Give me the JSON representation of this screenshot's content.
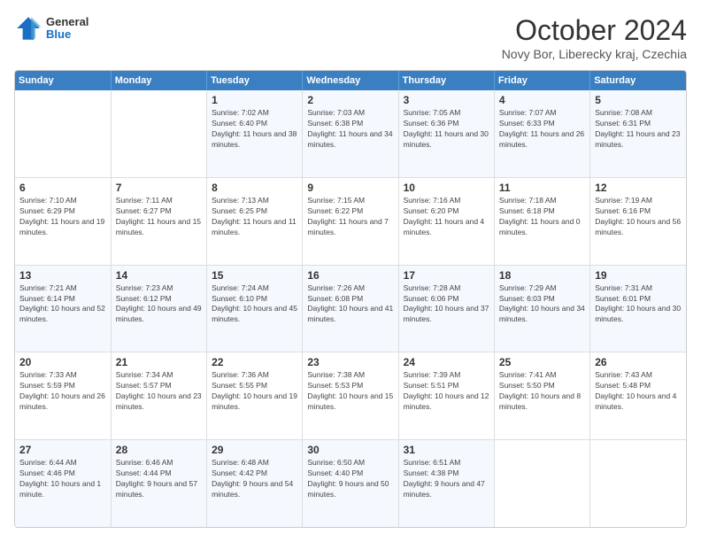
{
  "logo": {
    "general": "General",
    "blue": "Blue"
  },
  "header": {
    "month": "October 2024",
    "location": "Novy Bor, Liberecky kraj, Czechia"
  },
  "days_of_week": [
    "Sunday",
    "Monday",
    "Tuesday",
    "Wednesday",
    "Thursday",
    "Friday",
    "Saturday"
  ],
  "weeks": [
    [
      {
        "day": "",
        "info": ""
      },
      {
        "day": "",
        "info": ""
      },
      {
        "day": "1",
        "info": "Sunrise: 7:02 AM\nSunset: 6:40 PM\nDaylight: 11 hours and 38 minutes."
      },
      {
        "day": "2",
        "info": "Sunrise: 7:03 AM\nSunset: 6:38 PM\nDaylight: 11 hours and 34 minutes."
      },
      {
        "day": "3",
        "info": "Sunrise: 7:05 AM\nSunset: 6:36 PM\nDaylight: 11 hours and 30 minutes."
      },
      {
        "day": "4",
        "info": "Sunrise: 7:07 AM\nSunset: 6:33 PM\nDaylight: 11 hours and 26 minutes."
      },
      {
        "day": "5",
        "info": "Sunrise: 7:08 AM\nSunset: 6:31 PM\nDaylight: 11 hours and 23 minutes."
      }
    ],
    [
      {
        "day": "6",
        "info": "Sunrise: 7:10 AM\nSunset: 6:29 PM\nDaylight: 11 hours and 19 minutes."
      },
      {
        "day": "7",
        "info": "Sunrise: 7:11 AM\nSunset: 6:27 PM\nDaylight: 11 hours and 15 minutes."
      },
      {
        "day": "8",
        "info": "Sunrise: 7:13 AM\nSunset: 6:25 PM\nDaylight: 11 hours and 11 minutes."
      },
      {
        "day": "9",
        "info": "Sunrise: 7:15 AM\nSunset: 6:22 PM\nDaylight: 11 hours and 7 minutes."
      },
      {
        "day": "10",
        "info": "Sunrise: 7:16 AM\nSunset: 6:20 PM\nDaylight: 11 hours and 4 minutes."
      },
      {
        "day": "11",
        "info": "Sunrise: 7:18 AM\nSunset: 6:18 PM\nDaylight: 11 hours and 0 minutes."
      },
      {
        "day": "12",
        "info": "Sunrise: 7:19 AM\nSunset: 6:16 PM\nDaylight: 10 hours and 56 minutes."
      }
    ],
    [
      {
        "day": "13",
        "info": "Sunrise: 7:21 AM\nSunset: 6:14 PM\nDaylight: 10 hours and 52 minutes."
      },
      {
        "day": "14",
        "info": "Sunrise: 7:23 AM\nSunset: 6:12 PM\nDaylight: 10 hours and 49 minutes."
      },
      {
        "day": "15",
        "info": "Sunrise: 7:24 AM\nSunset: 6:10 PM\nDaylight: 10 hours and 45 minutes."
      },
      {
        "day": "16",
        "info": "Sunrise: 7:26 AM\nSunset: 6:08 PM\nDaylight: 10 hours and 41 minutes."
      },
      {
        "day": "17",
        "info": "Sunrise: 7:28 AM\nSunset: 6:06 PM\nDaylight: 10 hours and 37 minutes."
      },
      {
        "day": "18",
        "info": "Sunrise: 7:29 AM\nSunset: 6:03 PM\nDaylight: 10 hours and 34 minutes."
      },
      {
        "day": "19",
        "info": "Sunrise: 7:31 AM\nSunset: 6:01 PM\nDaylight: 10 hours and 30 minutes."
      }
    ],
    [
      {
        "day": "20",
        "info": "Sunrise: 7:33 AM\nSunset: 5:59 PM\nDaylight: 10 hours and 26 minutes."
      },
      {
        "day": "21",
        "info": "Sunrise: 7:34 AM\nSunset: 5:57 PM\nDaylight: 10 hours and 23 minutes."
      },
      {
        "day": "22",
        "info": "Sunrise: 7:36 AM\nSunset: 5:55 PM\nDaylight: 10 hours and 19 minutes."
      },
      {
        "day": "23",
        "info": "Sunrise: 7:38 AM\nSunset: 5:53 PM\nDaylight: 10 hours and 15 minutes."
      },
      {
        "day": "24",
        "info": "Sunrise: 7:39 AM\nSunset: 5:51 PM\nDaylight: 10 hours and 12 minutes."
      },
      {
        "day": "25",
        "info": "Sunrise: 7:41 AM\nSunset: 5:50 PM\nDaylight: 10 hours and 8 minutes."
      },
      {
        "day": "26",
        "info": "Sunrise: 7:43 AM\nSunset: 5:48 PM\nDaylight: 10 hours and 4 minutes."
      }
    ],
    [
      {
        "day": "27",
        "info": "Sunrise: 6:44 AM\nSunset: 4:46 PM\nDaylight: 10 hours and 1 minute."
      },
      {
        "day": "28",
        "info": "Sunrise: 6:46 AM\nSunset: 4:44 PM\nDaylight: 9 hours and 57 minutes."
      },
      {
        "day": "29",
        "info": "Sunrise: 6:48 AM\nSunset: 4:42 PM\nDaylight: 9 hours and 54 minutes."
      },
      {
        "day": "30",
        "info": "Sunrise: 6:50 AM\nSunset: 4:40 PM\nDaylight: 9 hours and 50 minutes."
      },
      {
        "day": "31",
        "info": "Sunrise: 6:51 AM\nSunset: 4:38 PM\nDaylight: 9 hours and 47 minutes."
      },
      {
        "day": "",
        "info": ""
      },
      {
        "day": "",
        "info": ""
      }
    ]
  ]
}
